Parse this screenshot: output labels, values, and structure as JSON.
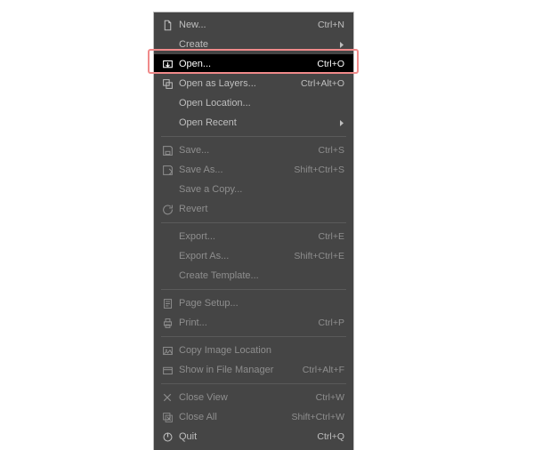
{
  "menu": [
    {
      "id": "new",
      "icon": "doc-new",
      "label": "New...",
      "accel": "Ctrl+N",
      "sub": false,
      "disabled": false,
      "group": 0
    },
    {
      "id": "create",
      "icon": "",
      "label": "Create",
      "accel": "",
      "sub": true,
      "disabled": false,
      "group": 0
    },
    {
      "id": "open",
      "icon": "import",
      "label": "Open...",
      "accel": "Ctrl+O",
      "sub": false,
      "disabled": false,
      "group": 0,
      "highlight": true
    },
    {
      "id": "open-layers",
      "icon": "layers",
      "label": "Open as Layers...",
      "accel": "Ctrl+Alt+O",
      "sub": false,
      "disabled": false,
      "group": 0
    },
    {
      "id": "open-location",
      "icon": "",
      "label": "Open Location...",
      "accel": "",
      "sub": false,
      "disabled": false,
      "group": 0
    },
    {
      "id": "open-recent",
      "icon": "",
      "label": "Open Recent",
      "accel": "",
      "sub": true,
      "disabled": false,
      "group": 0
    },
    {
      "id": "save",
      "icon": "save",
      "label": "Save...",
      "accel": "Ctrl+S",
      "sub": false,
      "disabled": true,
      "group": 1
    },
    {
      "id": "save-as",
      "icon": "save-as",
      "label": "Save As...",
      "accel": "Shift+Ctrl+S",
      "sub": false,
      "disabled": true,
      "group": 1
    },
    {
      "id": "save-copy",
      "icon": "",
      "label": "Save a Copy...",
      "accel": "",
      "sub": false,
      "disabled": true,
      "group": 1
    },
    {
      "id": "revert",
      "icon": "revert",
      "label": "Revert",
      "accel": "",
      "sub": false,
      "disabled": true,
      "group": 1
    },
    {
      "id": "export",
      "icon": "",
      "label": "Export...",
      "accel": "Ctrl+E",
      "sub": false,
      "disabled": true,
      "group": 2
    },
    {
      "id": "export-as",
      "icon": "",
      "label": "Export As...",
      "accel": "Shift+Ctrl+E",
      "sub": false,
      "disabled": true,
      "group": 2
    },
    {
      "id": "create-template",
      "icon": "",
      "label": "Create Template...",
      "accel": "",
      "sub": false,
      "disabled": true,
      "group": 2
    },
    {
      "id": "page-setup",
      "icon": "page-setup",
      "label": "Page Setup...",
      "accel": "",
      "sub": false,
      "disabled": true,
      "group": 3
    },
    {
      "id": "print",
      "icon": "print",
      "label": "Print...",
      "accel": "Ctrl+P",
      "sub": false,
      "disabled": true,
      "group": 3
    },
    {
      "id": "copy-image-loc",
      "icon": "image",
      "label": "Copy Image Location",
      "accel": "",
      "sub": false,
      "disabled": true,
      "group": 4
    },
    {
      "id": "show-in-fm",
      "icon": "file-mgr",
      "label": "Show in File Manager",
      "accel": "Ctrl+Alt+F",
      "sub": false,
      "disabled": true,
      "group": 4
    },
    {
      "id": "close-view",
      "icon": "close",
      "label": "Close View",
      "accel": "Ctrl+W",
      "sub": false,
      "disabled": true,
      "group": 5
    },
    {
      "id": "close-all",
      "icon": "close-all",
      "label": "Close All",
      "accel": "Shift+Ctrl+W",
      "sub": false,
      "disabled": true,
      "group": 5
    },
    {
      "id": "quit",
      "icon": "quit",
      "label": "Quit",
      "accel": "Ctrl+Q",
      "sub": false,
      "disabled": false,
      "group": 5
    }
  ]
}
